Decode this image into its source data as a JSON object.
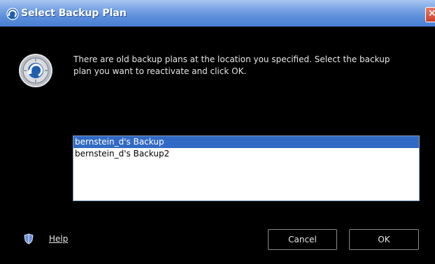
{
  "window": {
    "title": "Select Backup Plan",
    "close_label": "×"
  },
  "dialog": {
    "message": "There are old backup plans at the location you specified.  Select the backup plan you want to reactivate and click OK.",
    "plans": [
      {
        "label": "bernstein_d's Backup",
        "selected": true
      },
      {
        "label": "bernstein_d's Backup2",
        "selected": false
      }
    ]
  },
  "footer": {
    "help_label": "Help",
    "cancel_label": "Cancel",
    "ok_label": "OK"
  },
  "colors": {
    "titlebar": "#5a8ddb",
    "selection": "#316ac5",
    "background": "#000000"
  }
}
